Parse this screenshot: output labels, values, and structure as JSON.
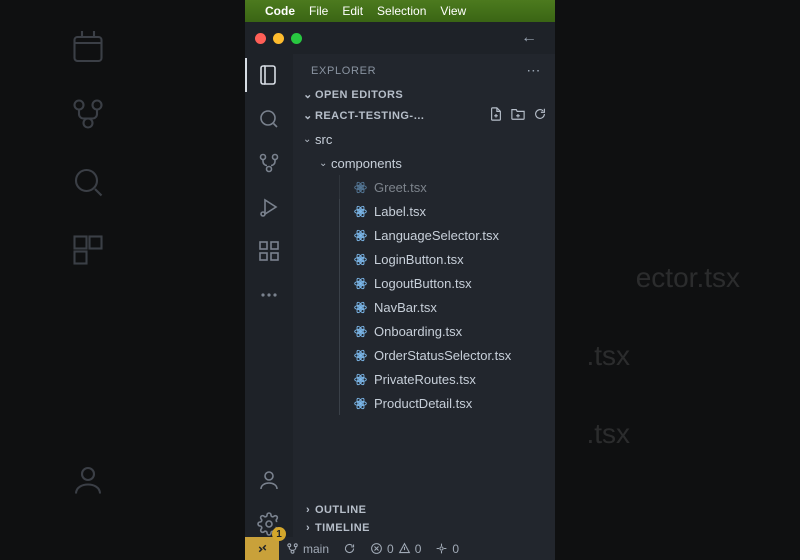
{
  "menu": {
    "apple": "",
    "app": "Code",
    "items": [
      "File",
      "Edit",
      "Selection",
      "View"
    ]
  },
  "sidebar": {
    "title": "EXPLORER",
    "sections": {
      "open_editors": "OPEN EDITORS",
      "workspace": "REACT-TESTING-…",
      "outline": "OUTLINE",
      "timeline": "TIMELINE"
    },
    "tree": {
      "folders": [
        {
          "name": "src",
          "depth": 0,
          "expanded": true
        },
        {
          "name": "components",
          "depth": 1,
          "expanded": true
        }
      ],
      "files": [
        {
          "name": "Greet.tsx",
          "cut": true
        },
        {
          "name": "Label.tsx"
        },
        {
          "name": "LanguageSelector.tsx"
        },
        {
          "name": "LoginButton.tsx"
        },
        {
          "name": "LogoutButton.tsx"
        },
        {
          "name": "NavBar.tsx"
        },
        {
          "name": "Onboarding.tsx"
        },
        {
          "name": "OrderStatusSelector.tsx"
        },
        {
          "name": "PrivateRoutes.tsx"
        },
        {
          "name": "ProductDetail.tsx"
        }
      ]
    }
  },
  "activity": {
    "settings_badge": "1"
  },
  "status": {
    "branch": "main",
    "errors": "0",
    "warnings": "0",
    "ports": "0"
  },
  "shadow": {
    "right1": "ector.tsx",
    "right2": ".tsx",
    "right3": ".tsx"
  }
}
